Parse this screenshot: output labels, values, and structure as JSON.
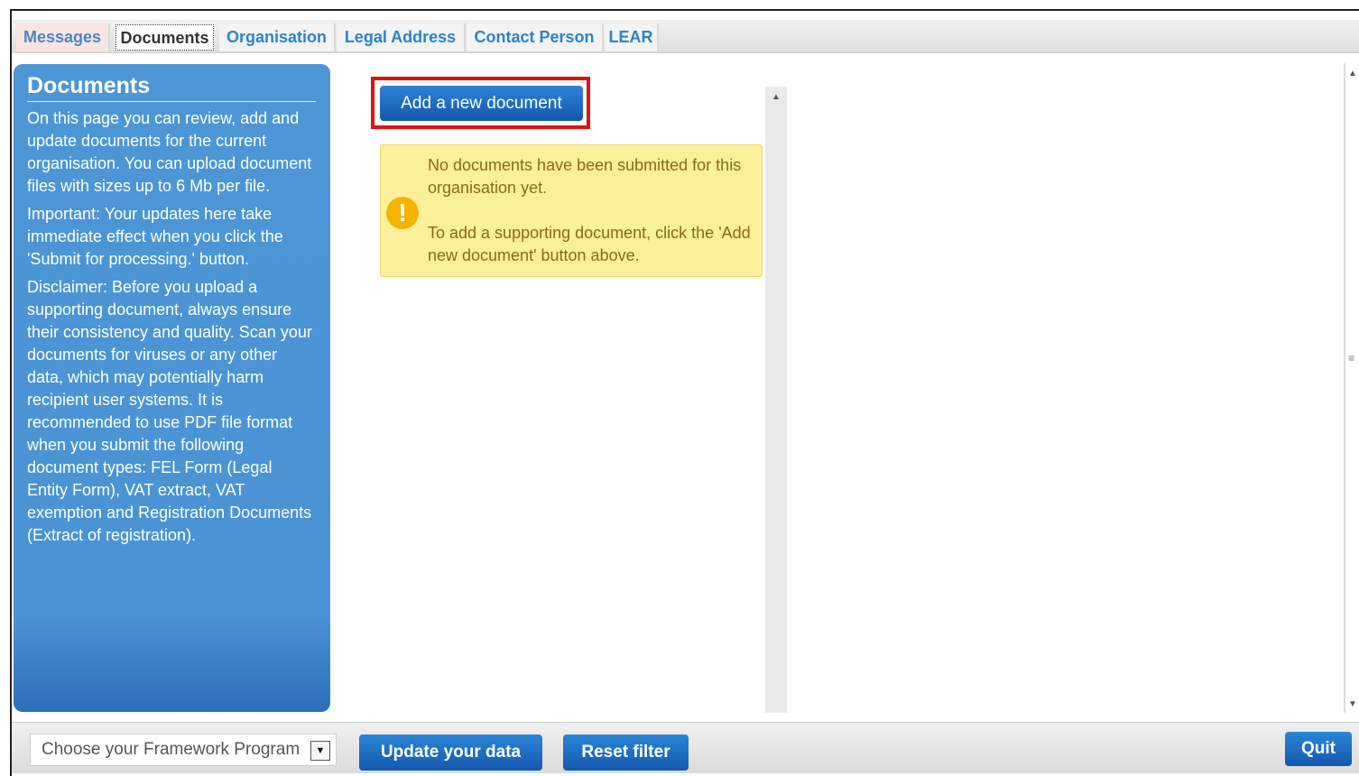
{
  "tabs": [
    {
      "label": "Messages"
    },
    {
      "label": "Documents"
    },
    {
      "label": "Organisation"
    },
    {
      "label": "Legal Address"
    },
    {
      "label": "Contact Person"
    },
    {
      "label": "LEAR"
    }
  ],
  "sidebar": {
    "title": "Documents",
    "paragraphs": [
      "On this page you can review, add and update documents for the current organisation. You can upload document files with sizes up to 6 Mb per file.",
      "Important: Your updates here take immediate effect when you click the 'Submit for processing.' button.",
      "Disclaimer: Before you upload a supporting document, always ensure their consistency and quality. Scan your documents for viruses or any other data, which may potentially harm recipient user systems. It is recommended to use PDF file format when you submit the following document types: FEL Form (Legal Entity Form), VAT extract, VAT exemption and Registration Documents (Extract of registration)."
    ]
  },
  "main": {
    "add_button": "Add a new document",
    "notice": {
      "icon": "warning-icon",
      "icon_glyph": "!",
      "line1": "No documents have been submitted for this organisation yet.",
      "line2": "To add a supporting document, click the 'Add new document' button above."
    }
  },
  "footer": {
    "select_value": "Choose your Framework Program",
    "update_button": "Update your data",
    "reset_button": "Reset filter",
    "quit_button": "Quit"
  },
  "colors": {
    "accent": "#1f6fc3",
    "sidebar": "#4a93d4",
    "highlight": "#e31010",
    "notice": "#fbf09a"
  }
}
